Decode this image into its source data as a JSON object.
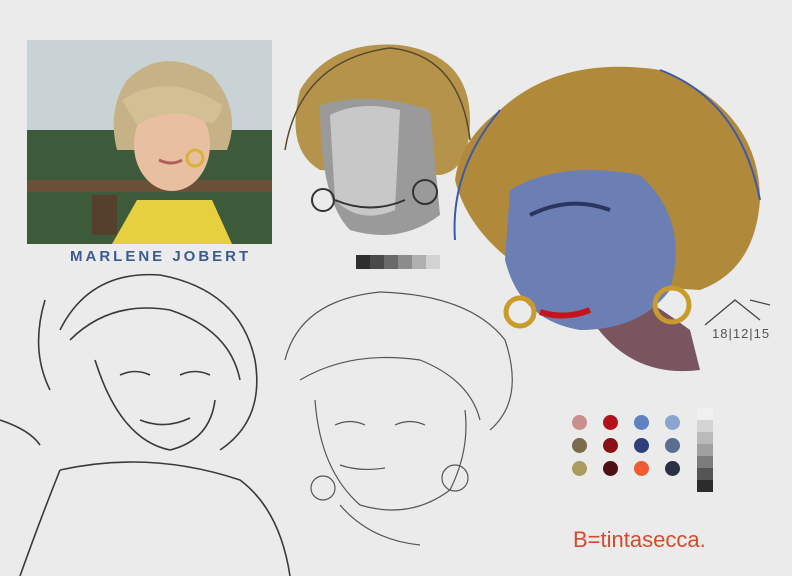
{
  "caption": "MARLENE JOBERT",
  "signature_date": "18|12|15",
  "credit": "B=tintasecca.",
  "grey_swatches": [
    "#2f2f2f",
    "#4a4a4a",
    "#6a6a6a",
    "#8c8c8c",
    "#b0b0b0",
    "#d2d2d2"
  ],
  "palette": [
    {
      "color": "#c98e8e"
    },
    {
      "color": "#b3121a"
    },
    {
      "color": "#5f82c2"
    },
    {
      "color": "#8aa6cf"
    },
    {
      "color": "#7a6a4e"
    },
    {
      "color": "#8a1018"
    },
    {
      "color": "#2f3f7a"
    },
    {
      "color": "#5a6e93"
    },
    {
      "color": "#a99c5c"
    },
    {
      "color": "#4e1014"
    },
    {
      "color": "#f25a33"
    },
    {
      "color": "#2a3142"
    }
  ],
  "value_swatches": [
    "#f0f0f0",
    "#d4d4d4",
    "#bababa",
    "#a0a0a0",
    "#7c7c7c",
    "#555555",
    "#2c2c2c"
  ],
  "colors": {
    "hair": "#b08a3a",
    "skin_blue": "#6b7fb5",
    "lips": "#c4141c",
    "earring": "#c99b2a",
    "sketch_line": "#3a3a3a"
  }
}
